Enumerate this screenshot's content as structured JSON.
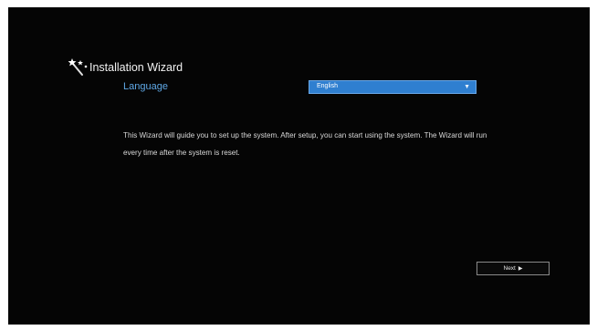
{
  "wizard": {
    "title": "Installation Wizard",
    "icon": "magic-wand-icon",
    "language_label": "Language",
    "language_selected": "English",
    "description": "This Wizard will guide you to set up the system. After setup, you can start using the system. The Wizard will run every time after the system is reset.",
    "next_label": "Next",
    "next_arrow": "▶",
    "dropdown_arrow": "▼"
  },
  "colors": {
    "background": "#050505",
    "accent": "#5fa8e6",
    "select_bg": "#2f7fd0"
  }
}
